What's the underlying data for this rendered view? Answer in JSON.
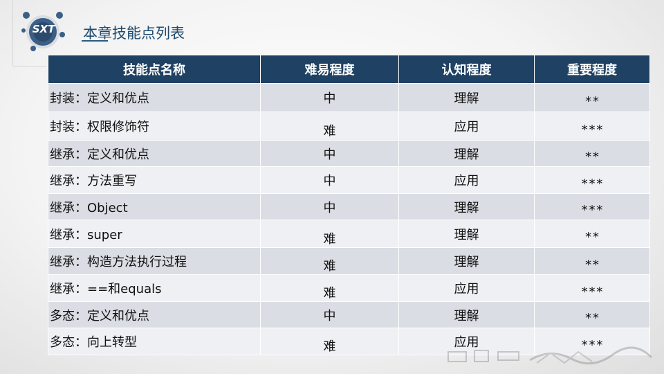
{
  "header": {
    "logo_text": "SXT",
    "title": "本章技能点列表"
  },
  "table": {
    "columns": [
      "技能点名称",
      "难易程度",
      "认知程度",
      "重要程度"
    ],
    "rows": [
      {
        "name": "封装：定义和优点",
        "difficulty": "中",
        "cognition": "理解",
        "importance": "**"
      },
      {
        "name": "封装：权限修饰符",
        "difficulty": "难",
        "cognition": "应用",
        "importance": "***"
      },
      {
        "name": "继承：定义和优点",
        "difficulty": "中",
        "cognition": "理解",
        "importance": "**"
      },
      {
        "name": "继承：方法重写",
        "difficulty": "中",
        "cognition": "应用",
        "importance": "***"
      },
      {
        "name": "继承：Object",
        "difficulty": "中",
        "cognition": "理解",
        "importance": "***"
      },
      {
        "name": "继承：super",
        "difficulty": "难",
        "cognition": "理解",
        "importance": "**"
      },
      {
        "name": "继承：构造方法执行过程",
        "difficulty": "难",
        "cognition": "理解",
        "importance": "**"
      },
      {
        "name": "继承：==和equals",
        "difficulty": "难",
        "cognition": "应用",
        "importance": "***"
      },
      {
        "name": "多态：定义和优点",
        "difficulty": "中",
        "cognition": "理解",
        "importance": "**"
      },
      {
        "name": "多态：向上转型",
        "difficulty": "难",
        "cognition": "应用",
        "importance": "***"
      }
    ]
  },
  "colors": {
    "header_bg": "#1f4163",
    "row_odd": "#dadde3",
    "row_even": "#eef0f3",
    "title": "#1f4a6e"
  }
}
